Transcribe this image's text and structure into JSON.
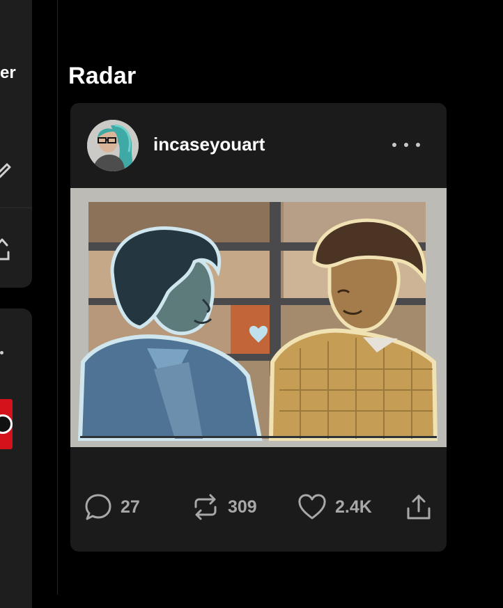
{
  "sidebar": {
    "partial_text": "er"
  },
  "section": {
    "title": "Radar"
  },
  "post": {
    "author": {
      "username": "incaseyouart",
      "avatar_icon": "avatar-image"
    },
    "image": {
      "description_icon": "illustration-image"
    },
    "actions": {
      "replies": "27",
      "reblogs": "309",
      "likes": "2.4K"
    }
  },
  "colors": {
    "background": "#000000",
    "card": "#1b1b1b",
    "muted_text": "#a8a8a8",
    "accent_red": "#d3121b"
  }
}
